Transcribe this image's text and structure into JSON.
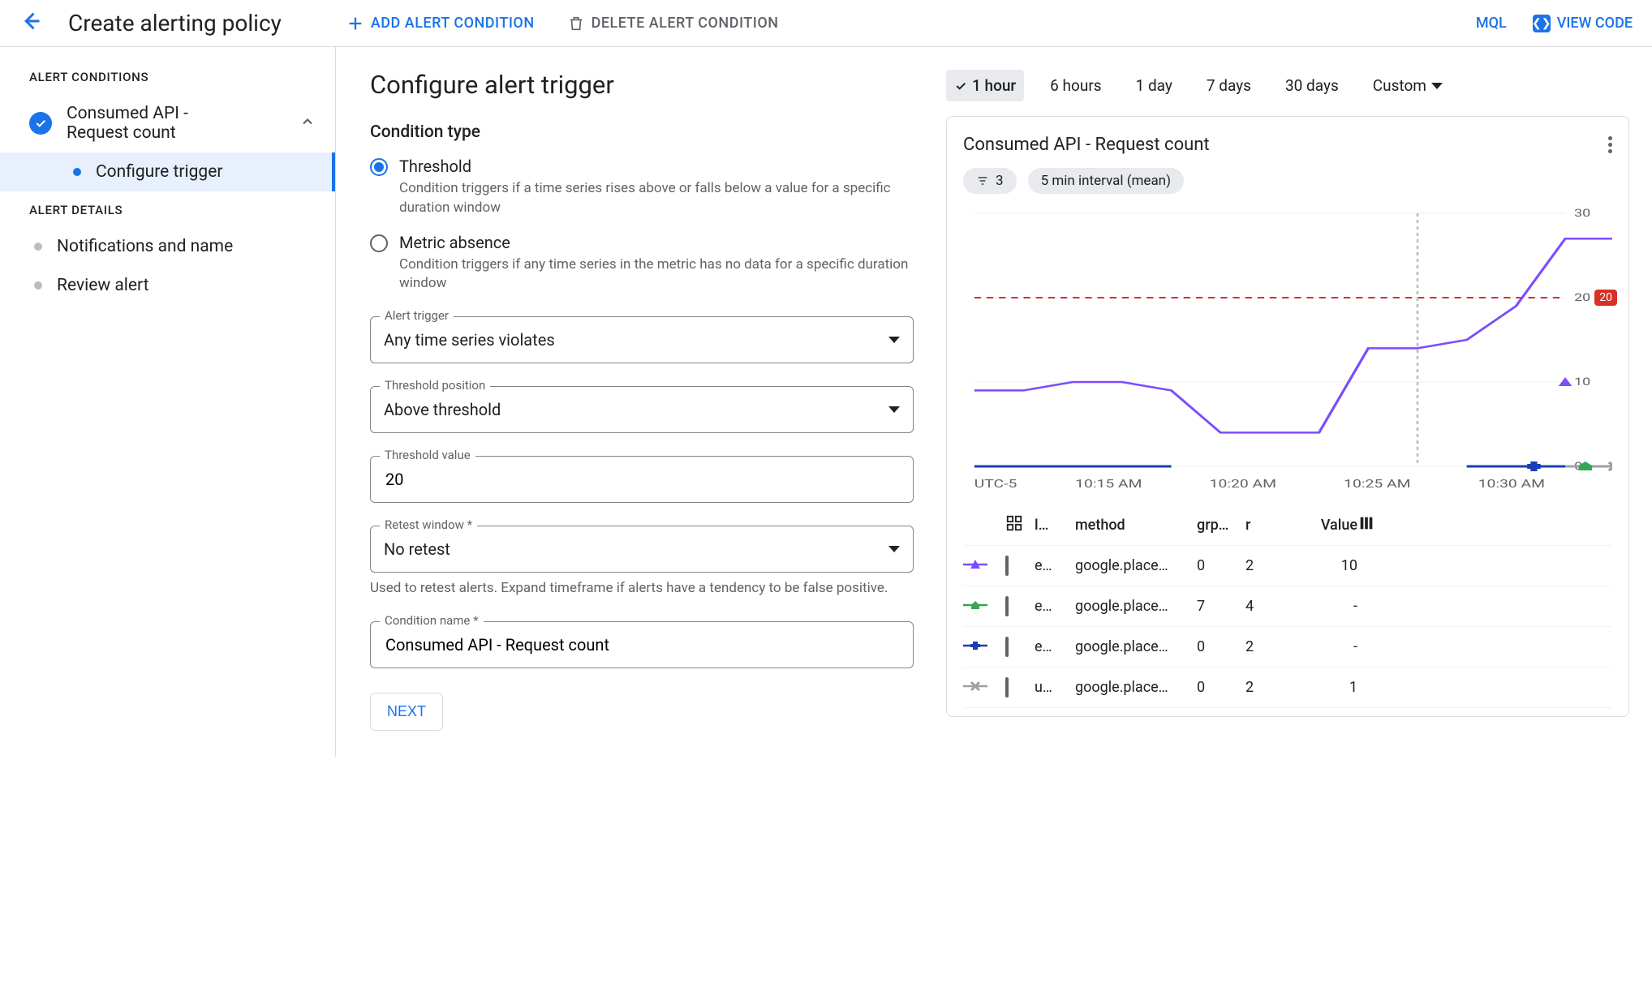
{
  "header": {
    "title": "Create alerting policy",
    "add": "ADD ALERT CONDITION",
    "del": "DELETE ALERT CONDITION",
    "mql": "MQL",
    "view_code": "VIEW CODE"
  },
  "sidebar": {
    "sec1": "ALERT CONDITIONS",
    "cond": {
      "line1": "Consumed API -",
      "line2": "Request count"
    },
    "config": "Configure trigger",
    "sec2": "ALERT DETAILS",
    "notif": "Notifications and name",
    "review": "Review alert"
  },
  "form": {
    "h2": "Configure alert trigger",
    "cond_type": "Condition type",
    "threshold": {
      "title": "Threshold",
      "desc": "Condition triggers if a time series rises above or falls below a value for a specific duration window"
    },
    "absence": {
      "title": "Metric absence",
      "desc": "Condition triggers if any time series in the metric has no data for a specific duration window"
    },
    "trigger": {
      "label": "Alert trigger",
      "value": "Any time series violates"
    },
    "position": {
      "label": "Threshold position",
      "value": "Above threshold"
    },
    "thval": {
      "label": "Threshold value",
      "value": "20"
    },
    "retest": {
      "label": "Retest window *",
      "value": "No retest",
      "helper": "Used to retest alerts. Expand timeframe if alerts have a tendency to be false positive."
    },
    "condname": {
      "label": "Condition name *",
      "value": "Consumed API - Request count"
    },
    "next": "NEXT"
  },
  "preview": {
    "ranges": [
      "1 hour",
      "6 hours",
      "1 day",
      "7 days",
      "30 days"
    ],
    "custom": "Custom",
    "title": "Consumed API - Request count",
    "filter_count": "3",
    "interval_chip": "5 min interval (mean)",
    "y_ticks": [
      "30",
      "20",
      "10",
      "0"
    ],
    "x_tz": "UTC-5",
    "x_ticks": [
      "10:15 AM",
      "10:20 AM",
      "10:25 AM",
      "10:30 AM"
    ],
    "threshold_badge": "20",
    "cols": {
      "l": "l…",
      "method": "method",
      "grp": "grp…",
      "r": "r",
      "value": "Value"
    },
    "rows": [
      {
        "mark": "tri",
        "color": "#7c4dff",
        "l": "e…",
        "method": "google.place…",
        "grp": "0",
        "r": "2",
        "value": "10"
      },
      {
        "mark": "home",
        "color": "#34a853",
        "l": "e…",
        "method": "google.place…",
        "grp": "7",
        "r": "4",
        "value": "-"
      },
      {
        "mark": "plus",
        "color": "#1a3fb5",
        "l": "e…",
        "method": "google.place…",
        "grp": "0",
        "r": "2",
        "value": "-"
      },
      {
        "mark": "x",
        "color": "#9aa0a6",
        "l": "u…",
        "method": "google.place…",
        "grp": "0",
        "r": "2",
        "value": "1"
      }
    ]
  },
  "chart_data": {
    "type": "line",
    "title": "Consumed API - Request count",
    "xlabel": "",
    "ylabel": "",
    "ylim": [
      0,
      30
    ],
    "threshold": 20,
    "x": [
      "10:10",
      "10:12",
      "10:14",
      "10:16",
      "10:18",
      "10:20",
      "10:22",
      "10:24",
      "10:25",
      "10:26",
      "10:28",
      "10:30",
      "10:31"
    ],
    "series": [
      {
        "name": "e… google.place… (triangle, purple)",
        "color": "#7c4dff",
        "values": [
          9,
          9,
          10,
          10,
          9,
          4,
          4,
          4,
          14,
          14,
          15,
          19,
          27,
          27,
          10
        ]
      },
      {
        "name": "e… google.place… (home, green)",
        "color": "#34a853",
        "values": [
          null,
          null,
          null,
          null,
          null,
          null,
          null,
          null,
          null,
          null,
          0,
          0,
          0,
          null
        ]
      },
      {
        "name": "e… google.place… (plus, navy)",
        "color": "#1a3fb5",
        "values": [
          0,
          0,
          0,
          0,
          0,
          null,
          null,
          null,
          null,
          null,
          0,
          0,
          0,
          null
        ]
      },
      {
        "name": "u… google.place… (x, grey)",
        "color": "#9aa0a6",
        "values": [
          null,
          null,
          null,
          null,
          null,
          null,
          null,
          null,
          null,
          null,
          null,
          null,
          0,
          0
        ]
      }
    ],
    "x_ticks": [
      "10:15 AM",
      "10:20 AM",
      "10:25 AM",
      "10:30 AM"
    ],
    "y_ticks": [
      0,
      10,
      20,
      30
    ],
    "timezone": "UTC-5"
  }
}
